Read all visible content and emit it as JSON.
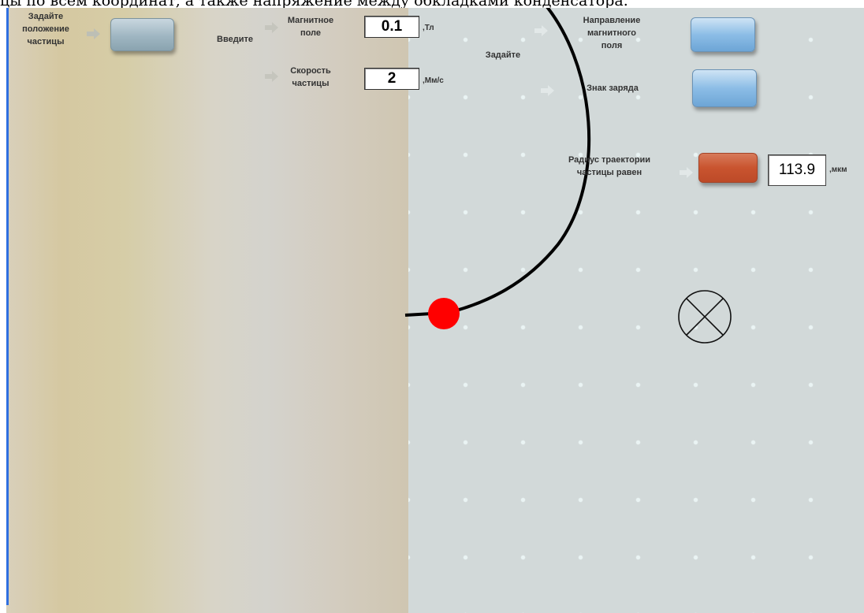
{
  "top_text": "цы по всем координат, а также напряжение между обкладками конденсатора.",
  "controls": {
    "set_position_label": "Задайте\nположение\nчастицы",
    "enter_label": "Введите",
    "magnetic_field_label": "Магнитное\nполе",
    "magnetic_field_value": "0.1",
    "magnetic_field_unit": ",Тл",
    "speed_label": "Скорость\nчастицы",
    "speed_value": "2",
    "speed_unit": ",Мм/с",
    "set_label": "Задайте",
    "field_direction_label": "Направление\nмагнитного\nполя",
    "charge_sign_label": "Знак заряда",
    "radius_label": "Радиус траектории\nчастицы равен",
    "radius_value": "113.9",
    "radius_unit": ",мкм"
  },
  "symbols": {
    "field_direction_symbol": "field-into-page-icon"
  },
  "colors": {
    "particle": "#ff0000",
    "result_button": "#c9542f",
    "blue_button": "#8cbde6",
    "border": "#2f6fe0"
  }
}
